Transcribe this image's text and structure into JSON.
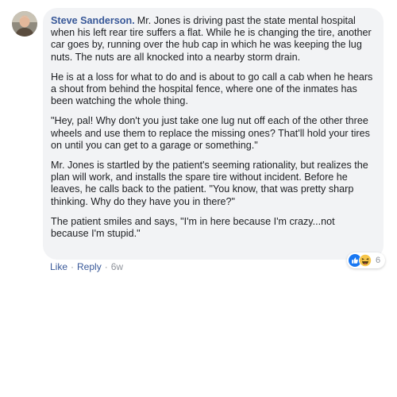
{
  "comment": {
    "author": "Steve Sanderson.",
    "paragraphs": [
      "Mr. Jones is driving past the state mental hospital when his left rear tire suffers a flat. While he is changing the tire, another car goes by, running over the hub cap in which he was keeping the lug nuts. The nuts are all knocked into a nearby storm drain.",
      "He is at a loss for what to do and is about to go call a cab when he hears a shout from behind the hospital fence, where one of the inmates has been watching the whole thing.",
      "\"Hey, pal! Why don't you just take one lug nut off each of the other three wheels and use them to replace the missing ones? That'll hold your tires on until you can get to a garage or something.\"",
      "Mr. Jones is startled by the patient's seeming rationality, but realizes the plan will work, and installs the spare tire without incident. Before he leaves, he calls back to the patient. \"You know, that was pretty sharp thinking. Why do they have you in there?\"",
      "The patient smiles and says, \"I'm in here because I'm crazy...not because I'm stupid.\""
    ],
    "reactions": {
      "icons": [
        "like-icon",
        "haha-icon"
      ],
      "count": "6"
    },
    "actions": {
      "like": "Like",
      "separator": "·",
      "reply": "Reply",
      "time": "6w"
    }
  },
  "colors": {
    "author": "#385898",
    "bubble_bg": "#f2f3f5",
    "text": "#1c1e21",
    "meta": "#90949c",
    "like_blue": "#1877f2",
    "haha_yellow": "#f7c64a"
  }
}
